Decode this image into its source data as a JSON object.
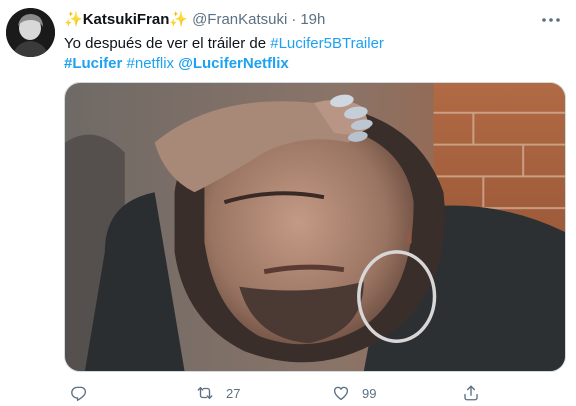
{
  "tweet": {
    "user": {
      "display_name": "KatsukiFran",
      "name_emoji_left": "✨",
      "name_emoji_right": "✨",
      "handle": "@FranKatsuki",
      "separator": "·",
      "time": "19h"
    },
    "text": {
      "line1_prefix": "Yo después de ver el tráiler de ",
      "line1_hashtag": "#Lucifer5BTrailer",
      "hashtag_lucifer": "#Lucifer",
      "hashtag_netflix": "#netflix",
      "mention": "@LuciferNetflix"
    },
    "actions": {
      "reply_icon": "reply-icon",
      "reply_count": "",
      "retweet_icon": "retweet-icon",
      "retweet_count": "27",
      "like_icon": "heart-icon",
      "like_count": "99",
      "share_icon": "share-icon"
    },
    "colors": {
      "accent": "#1da1f2",
      "secondary_text": "#5b7083",
      "primary_text": "#0f1419"
    }
  }
}
